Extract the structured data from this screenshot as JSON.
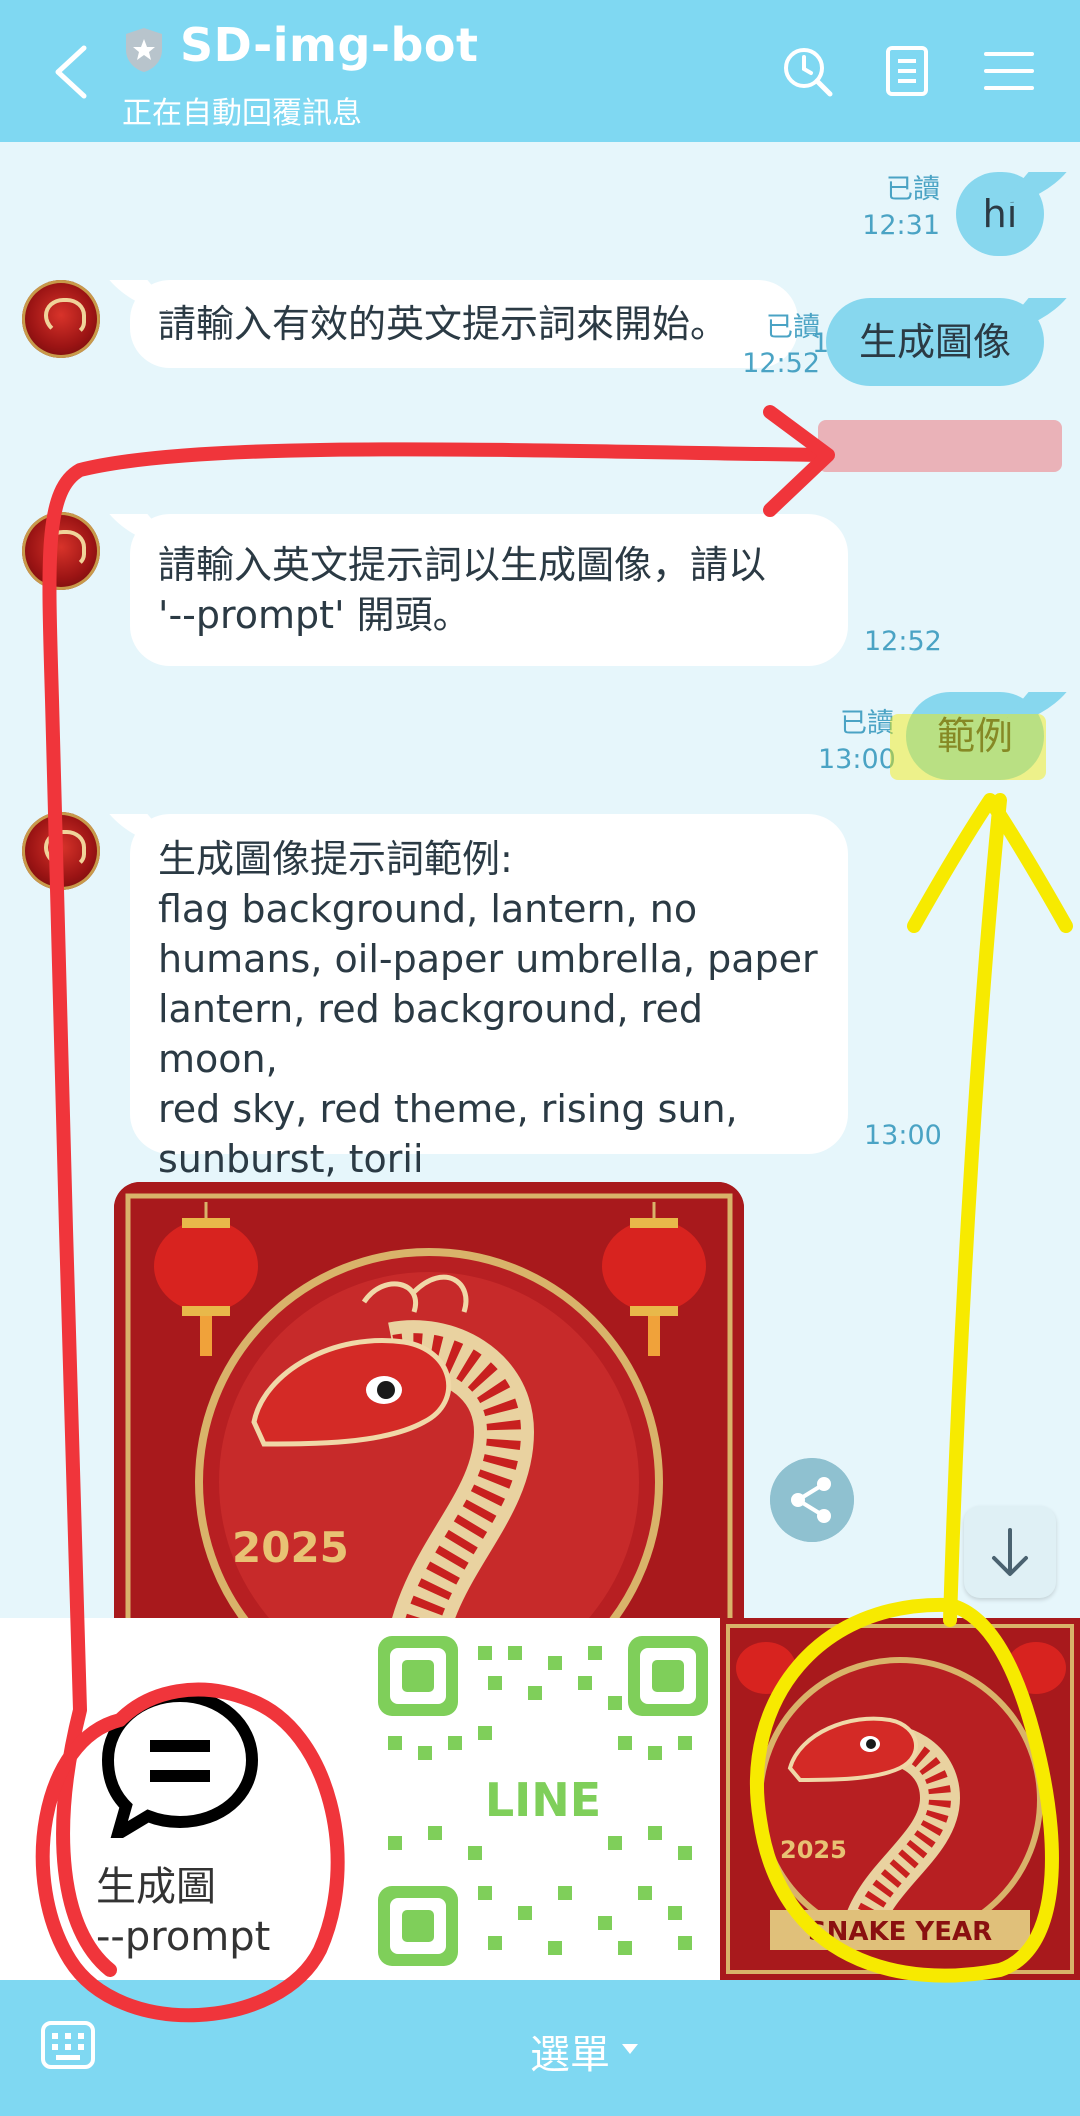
{
  "header": {
    "title": "SD-img-bot",
    "subtitle": "正在自動回覆訊息",
    "icons": [
      "back-icon",
      "shield-icon",
      "clock-icon",
      "note-icon",
      "menu-icon"
    ]
  },
  "messages": [
    {
      "dir": "out",
      "text": "hi",
      "read": "已讀",
      "time": "12:31"
    },
    {
      "dir": "in",
      "text": "請輸入有效的英文提示詞來開始。",
      "time": "12:31"
    },
    {
      "dir": "out",
      "text": "生成圖像",
      "read": "已讀",
      "time": "12:52"
    },
    {
      "dir": "in",
      "lines": [
        "請輸入英文提示詞以生成圖像，請以",
        "'--prompt' 開頭。"
      ],
      "time": "12:52"
    },
    {
      "dir": "out",
      "text": "範例",
      "read": "已讀",
      "time": "13:00"
    },
    {
      "dir": "in",
      "lines": [
        "生成圖像提示詞範例:",
        "flag background, lantern, no",
        "humans, oil-paper umbrella, paper",
        "lantern, red background, red moon,",
        "red sky, red theme, rising sun,",
        "sunburst, torii"
      ],
      "time": "13:00"
    }
  ],
  "image": {
    "year": "2025"
  },
  "richmenu": {
    "item1": {
      "line1": "生成圖",
      "line2": "--prompt",
      "icon": "chat-equals-icon"
    },
    "item2": {
      "qr_label": "LINE",
      "icon": "qr-code"
    },
    "item3": {
      "year": "2025",
      "banner": "SNAKE YEAR"
    }
  },
  "bottombar": {
    "menu_label": "選單",
    "icon": "keyboard-icon"
  },
  "annotation_colors": {
    "red": "#f0353b",
    "yellow": "#f7ea00"
  }
}
